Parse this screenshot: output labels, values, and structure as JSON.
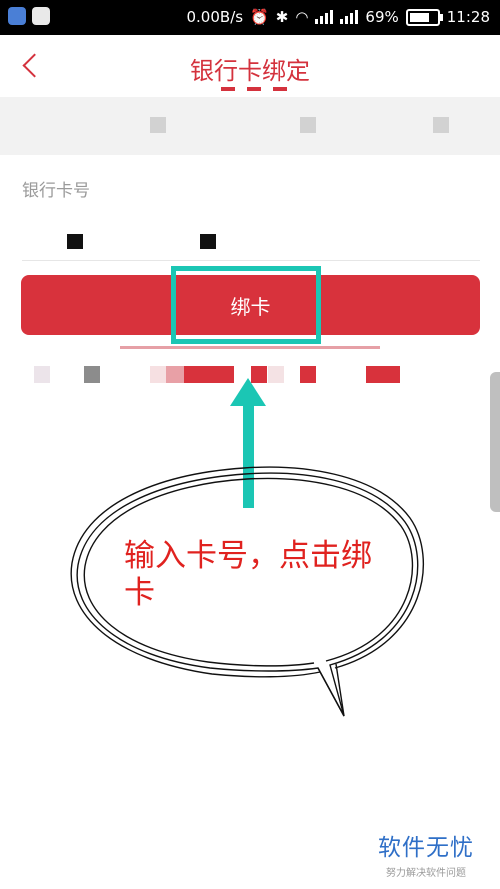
{
  "status_bar": {
    "speed": "0.00B/s",
    "battery": "69%",
    "time": "11:28"
  },
  "header": {
    "title": "银行卡绑定"
  },
  "form": {
    "card_label": "银行卡号"
  },
  "bind_button": {
    "label": "绑卡"
  },
  "annotation": {
    "text": "输入卡号，点击绑卡",
    "color": "#e0221f"
  },
  "watermark": {
    "main": "软件无忧",
    "sub": "努力解决软件问题"
  },
  "colors": {
    "accent": "#d8323c",
    "highlight": "#1bc6b4",
    "watermark": "#2f6fc7"
  }
}
